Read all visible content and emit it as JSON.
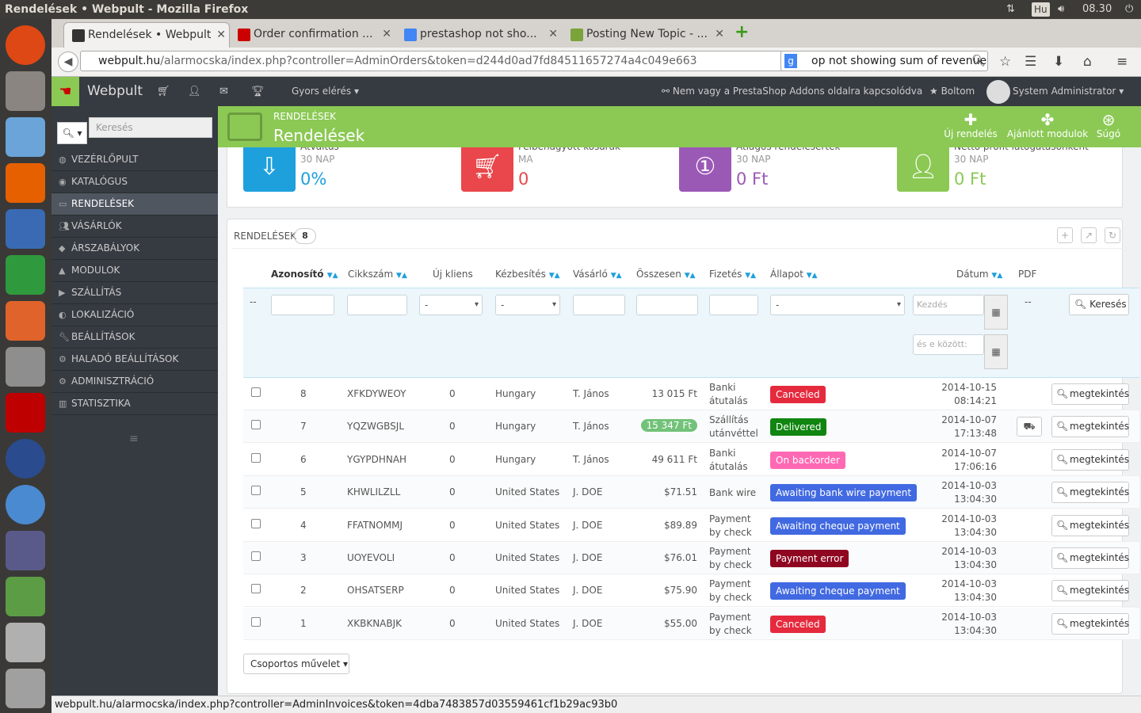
{
  "os": {
    "window_title": "Rendelések • Webpult - Mozilla Firefox",
    "keyboard": "Hu",
    "clock": "08.30"
  },
  "browser": {
    "tabs": [
      {
        "label": "Rendelések • Webpult",
        "active": true
      },
      {
        "label": "Order confirmation ...",
        "active": false
      },
      {
        "label": "prestashop not sho...",
        "active": false
      },
      {
        "label": "Posting New Topic - ...",
        "active": false
      }
    ],
    "url_domain": "webpult.hu",
    "url_path": "/alarmocska/index.php?controller=AdminOrders&token=d244d0ad7fd84511657274a4c049e663",
    "search_value": "op not showing sum of revenue",
    "status_url": "webpult.hu/alarmocska/index.php?controller=AdminInvoices&token=4dba7483857d03559461cf1b29ac93b0"
  },
  "header": {
    "brand": "Webpult",
    "quick_access": "Gyors elérés",
    "addons_notice": "Nem vagy a PrestaShop Addons oldalra kapcsolódva",
    "shop_link": "Boltom",
    "user": "System Administrator"
  },
  "sidebar": {
    "search_placeholder": "Keresés",
    "items": [
      {
        "label": "VEZÉRLŐPULT",
        "active": false
      },
      {
        "label": "KATALÓGUS",
        "active": false
      },
      {
        "label": "RENDELÉSEK",
        "active": true
      },
      {
        "label": "VÁSÁRLÓK",
        "active": false
      },
      {
        "label": "ÁRSZABÁLYOK",
        "active": false
      },
      {
        "label": "MODULOK",
        "active": false
      },
      {
        "label": "SZÁLLÍTÁS",
        "active": false
      },
      {
        "label": "LOKALIZÁCIÓ",
        "active": false
      },
      {
        "label": "BEÁLLÍTÁSOK",
        "active": false
      },
      {
        "label": "HALADÓ BEÁLLÍTÁSOK",
        "active": false
      },
      {
        "label": "ADMINISZTRÁCIÓ",
        "active": false
      },
      {
        "label": "STATISZTIKA",
        "active": false
      }
    ]
  },
  "page": {
    "breadcrumb": "RENDELÉSEK",
    "title": "Rendelések",
    "toolbar": {
      "new_order": "Új rendelés",
      "recommended": "Ajánlott modulok",
      "help": "Súgó"
    }
  },
  "kpis": [
    {
      "label": "Átváltás",
      "period": "30 NAP",
      "value": "0%",
      "color": "#1ea0dd"
    },
    {
      "label": "Félbehagyott kosarak",
      "period": "MA",
      "value": "0",
      "color": "#e9474c"
    },
    {
      "label": "Átlagos rendelésérték",
      "period": "30 NAP",
      "value": "0 Ft",
      "color": "#9b59b6"
    },
    {
      "label": "Nettó profit látogatásonként",
      "period": "30 NAP",
      "value": "0 Ft",
      "color": "#8bc954"
    }
  ],
  "orders_panel": {
    "title": "RENDELÉSEK",
    "count": "8",
    "columns": [
      "Azonosító",
      "Cikkszám",
      "Új kliens",
      "Kézbesítés",
      "Vásárló",
      "Összesen",
      "Fizetés",
      "Állapot",
      "Dátum",
      "PDF"
    ],
    "filter": {
      "placeholder_dash": "--",
      "select_dash": "-",
      "date_from_placeholder": "Kezdés",
      "date_to_placeholder": "és e között:",
      "pdf_dash": "--",
      "search_button": "Keresés"
    },
    "rows": [
      {
        "id": "8",
        "ref": "XFKDYWEOY",
        "new": "0",
        "country": "Hungary",
        "customer": "T. János",
        "total": "13 015 Ft",
        "pay1": "Banki",
        "pay2": "átutalás",
        "status": "Canceled",
        "status_color": "#e52a3d",
        "date": "2014-10-15",
        "time": "08:14:21",
        "highlight": false,
        "delivery": false
      },
      {
        "id": "7",
        "ref": "YQZWGBSJL",
        "new": "0",
        "country": "Hungary",
        "customer": "T. János",
        "total": "15 347 Ft",
        "pay1": "Szállítás",
        "pay2": "utánvéttel",
        "status": "Delivered",
        "status_color": "#108510",
        "date": "2014-10-07",
        "time": "17:13:48",
        "highlight": true,
        "delivery": true
      },
      {
        "id": "6",
        "ref": "YGYPDHNAH",
        "new": "0",
        "country": "Hungary",
        "customer": "T. János",
        "total": "49 611 Ft",
        "pay1": "Banki",
        "pay2": "átutalás",
        "status": "On backorder",
        "status_color": "#ff69b4",
        "date": "2014-10-07",
        "time": "17:06:16",
        "highlight": false,
        "delivery": false
      },
      {
        "id": "5",
        "ref": "KHWLILZLL",
        "new": "0",
        "country": "United States",
        "customer": "J. DOE",
        "total": "$71.51",
        "pay1": "Bank wire",
        "pay2": "",
        "status": "Awaiting bank wire payment",
        "status_color": "#4169e1",
        "date": "2014-10-03",
        "time": "13:04:30",
        "highlight": false,
        "delivery": false
      },
      {
        "id": "4",
        "ref": "FFATNOMMJ",
        "new": "0",
        "country": "United States",
        "customer": "J. DOE",
        "total": "$89.89",
        "pay1": "Payment",
        "pay2": "by check",
        "status": "Awaiting cheque payment",
        "status_color": "#4169e1",
        "date": "2014-10-03",
        "time": "13:04:30",
        "highlight": false,
        "delivery": false
      },
      {
        "id": "3",
        "ref": "UOYEVOLI",
        "new": "0",
        "country": "United States",
        "customer": "J. DOE",
        "total": "$76.01",
        "pay1": "Payment",
        "pay2": "by check",
        "status": "Payment error",
        "status_color": "#8f0621",
        "date": "2014-10-03",
        "time": "13:04:30",
        "highlight": false,
        "delivery": false
      },
      {
        "id": "2",
        "ref": "OHSATSERP",
        "new": "0",
        "country": "United States",
        "customer": "J. DOE",
        "total": "$75.90",
        "pay1": "Payment",
        "pay2": "by check",
        "status": "Awaiting cheque payment",
        "status_color": "#4169e1",
        "date": "2014-10-03",
        "time": "13:04:30",
        "highlight": false,
        "delivery": false
      },
      {
        "id": "1",
        "ref": "XKBKNABJK",
        "new": "0",
        "country": "United States",
        "customer": "J. DOE",
        "total": "$55.00",
        "pay1": "Payment",
        "pay2": "by check",
        "status": "Canceled",
        "status_color": "#e52a3d",
        "date": "2014-10-03",
        "time": "13:04:30",
        "highlight": false,
        "delivery": false
      }
    ],
    "view_button": "megtekintés",
    "bulk_action": "Csoportos művelet"
  }
}
